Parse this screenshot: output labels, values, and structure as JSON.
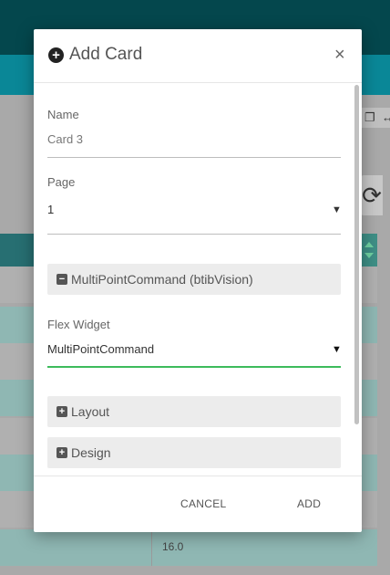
{
  "background": {
    "last_cell_value": "16.0"
  },
  "modal": {
    "title": "Add Card",
    "close_label": "×",
    "fields": {
      "name": {
        "label": "Name",
        "value": "Card 3"
      },
      "page": {
        "label": "Page",
        "value": "1"
      },
      "flex_widget": {
        "label": "Flex Widget",
        "value": "MultiPointCommand"
      }
    },
    "sections": {
      "widget_section": "MultiPointCommand (btibVision)",
      "layout": "Layout",
      "design": "Design"
    },
    "footer": {
      "cancel_label": "CANCEL",
      "add_label": "ADD"
    }
  },
  "colors": {
    "accent_green": "#3dbb5c",
    "header_dark_teal": "#04474d",
    "header_teal": "#0a8797"
  },
  "icons": {
    "title_icon": "plus-circle-icon",
    "expanded_section_icon": "minus-square-icon",
    "collapsed_section_icon": "plus-square-icon"
  }
}
